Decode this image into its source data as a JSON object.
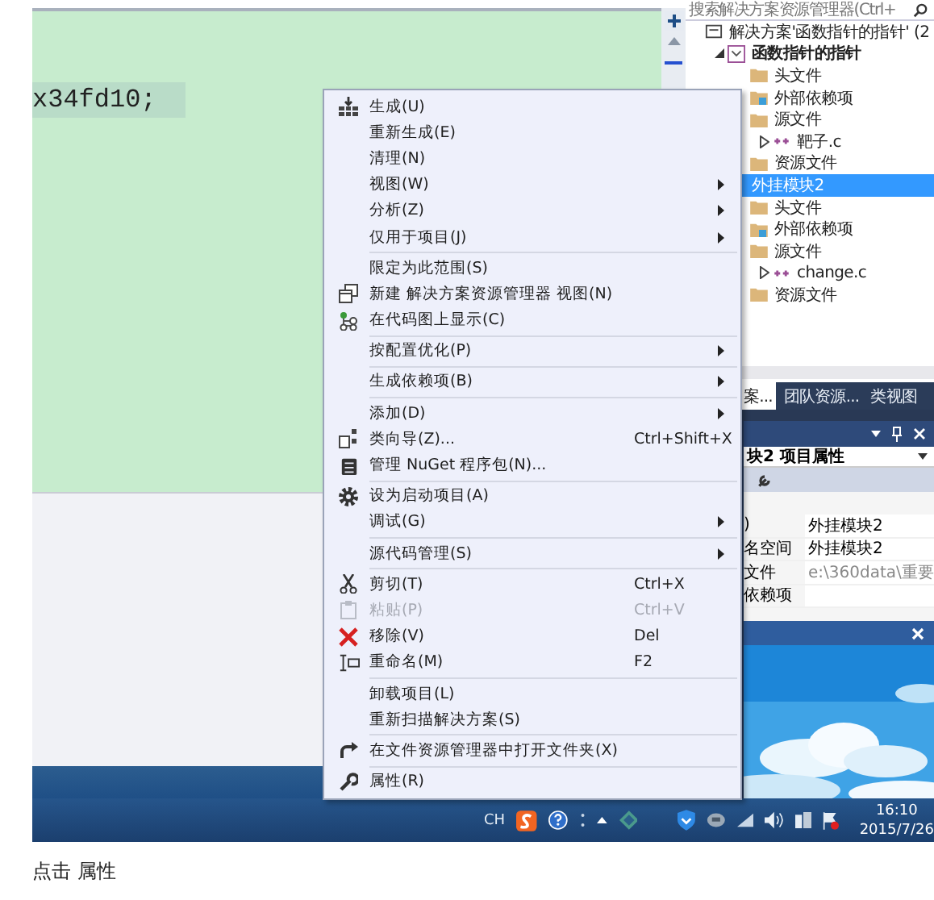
{
  "editor": {
    "code_line": "x34fd10;"
  },
  "context_menu": {
    "groups": [
      {
        "items": [
          {
            "kind": "build",
            "label": "生成(U)",
            "submenu": false,
            "disabled": false
          },
          {
            "kind": "plain",
            "label": "重新生成(E)",
            "submenu": false,
            "disabled": false
          },
          {
            "kind": "plain",
            "label": "清理(N)",
            "submenu": false,
            "disabled": false
          },
          {
            "kind": "plain",
            "label": "视图(W)",
            "submenu": true,
            "disabled": false
          },
          {
            "kind": "plain",
            "label": "分析(Z)",
            "submenu": true,
            "disabled": false
          },
          {
            "kind": "plain",
            "label": "仅用于项目(J)",
            "submenu": true,
            "disabled": false
          }
        ]
      },
      {
        "items": [
          {
            "kind": "plain",
            "label": "限定为此范围(S)",
            "submenu": false,
            "disabled": false
          },
          {
            "kind": "new-view",
            "label": "新建 解决方案资源管理器 视图(N)",
            "submenu": false,
            "disabled": false
          },
          {
            "kind": "code-map",
            "label": "在代码图上显示(C)",
            "submenu": false,
            "disabled": false
          }
        ]
      },
      {
        "items": [
          {
            "kind": "plain",
            "label": "按配置优化(P)",
            "submenu": true,
            "disabled": false
          }
        ]
      },
      {
        "items": [
          {
            "kind": "plain",
            "label": "生成依赖项(B)",
            "submenu": true,
            "disabled": false
          }
        ]
      },
      {
        "items": [
          {
            "kind": "plain",
            "label": "添加(D)",
            "submenu": true,
            "disabled": false
          },
          {
            "kind": "class-wizard",
            "label": "类向导(Z)...",
            "shortcut": "Ctrl+Shift+X",
            "submenu": false,
            "disabled": false
          },
          {
            "kind": "nuget",
            "label": "管理 NuGet 程序包(N)...",
            "submenu": false,
            "disabled": false
          }
        ]
      },
      {
        "items": [
          {
            "kind": "gear",
            "label": "设为启动项目(A)",
            "submenu": false,
            "disabled": false
          },
          {
            "kind": "plain",
            "label": "调试(G)",
            "submenu": true,
            "disabled": false
          }
        ]
      },
      {
        "items": [
          {
            "kind": "plain",
            "label": "源代码管理(S)",
            "submenu": true,
            "disabled": false
          }
        ]
      },
      {
        "items": [
          {
            "kind": "cut",
            "label": "剪切(T)",
            "shortcut": "Ctrl+X",
            "submenu": false,
            "disabled": false
          },
          {
            "kind": "paste",
            "label": "粘贴(P)",
            "shortcut": "Ctrl+V",
            "submenu": false,
            "disabled": true
          },
          {
            "kind": "remove",
            "label": "移除(V)",
            "shortcut": "Del",
            "submenu": false,
            "disabled": false
          },
          {
            "kind": "rename",
            "label": "重命名(M)",
            "shortcut": "F2",
            "submenu": false,
            "disabled": false
          }
        ]
      },
      {
        "items": [
          {
            "kind": "plain",
            "label": "卸载项目(L)",
            "submenu": false,
            "disabled": false
          },
          {
            "kind": "plain",
            "label": "重新扫描解决方案(S)",
            "submenu": false,
            "disabled": false
          }
        ]
      },
      {
        "items": [
          {
            "kind": "open-folder",
            "label": "在文件资源管理器中打开文件夹(X)",
            "submenu": false,
            "disabled": false
          }
        ]
      },
      {
        "items": [
          {
            "kind": "properties",
            "label": "属性(R)",
            "submenu": false,
            "disabled": false
          }
        ]
      }
    ]
  },
  "solution_explorer": {
    "search": {
      "placeholder": "搜索解决方案资源管理器(Ctrl+"
    },
    "tree": [
      {
        "kind": "solution",
        "label": "解决方案'函数指针的指针' (2",
        "bold": false,
        "selected": false,
        "children": [
          {
            "kind": "project",
            "label": "函数指针的指针",
            "bold": true,
            "selected": false,
            "expanded": true,
            "children": [
              {
                "kind": "folder",
                "label": "头文件",
                "bold": false,
                "selected": false
              },
              {
                "kind": "ref-folder",
                "label": "外部依赖项",
                "bold": false,
                "selected": false
              },
              {
                "kind": "folder",
                "label": "源文件",
                "bold": false,
                "selected": false,
                "children": [
                  {
                    "kind": "file-c",
                    "label": "靶子.c",
                    "bold": false,
                    "selected": false,
                    "expanded": false
                  }
                ]
              },
              {
                "kind": "folder",
                "label": "资源文件",
                "bold": false,
                "selected": false
              }
            ]
          },
          {
            "kind": "plain",
            "label": "外挂模块2",
            "bold": false,
            "selected": true,
            "children": [
              {
                "kind": "folder",
                "label": "头文件",
                "bold": false,
                "selected": false
              },
              {
                "kind": "ref-folder",
                "label": "外部依赖项",
                "bold": false,
                "selected": false
              },
              {
                "kind": "folder",
                "label": "源文件",
                "bold": false,
                "selected": false,
                "children": [
                  {
                    "kind": "file-c",
                    "label": "change.c",
                    "bold": false,
                    "selected": false,
                    "expanded": false
                  }
                ]
              },
              {
                "kind": "folder",
                "label": "资源文件",
                "bold": false,
                "selected": false
              }
            ]
          }
        ]
      }
    ],
    "tabs": [
      {
        "label": "案...",
        "selected": true
      },
      {
        "label": "团队资源...",
        "selected": false
      },
      {
        "label": "类视图",
        "selected": false
      }
    ]
  },
  "properties": {
    "title": "块2 项目属性",
    "rows": [
      {
        "name": ")",
        "value": "外挂模块2",
        "disabled": false
      },
      {
        "name": "名空间",
        "value": "外挂模块2",
        "disabled": false
      },
      {
        "name": "文件",
        "value": "e:\\360data\\重要",
        "disabled": true
      },
      {
        "name": "依赖项"
      }
    ]
  },
  "taskbar": {
    "language": "CH",
    "time": "16:10",
    "date": "2015/7/26"
  },
  "caption": "点击 属性"
}
